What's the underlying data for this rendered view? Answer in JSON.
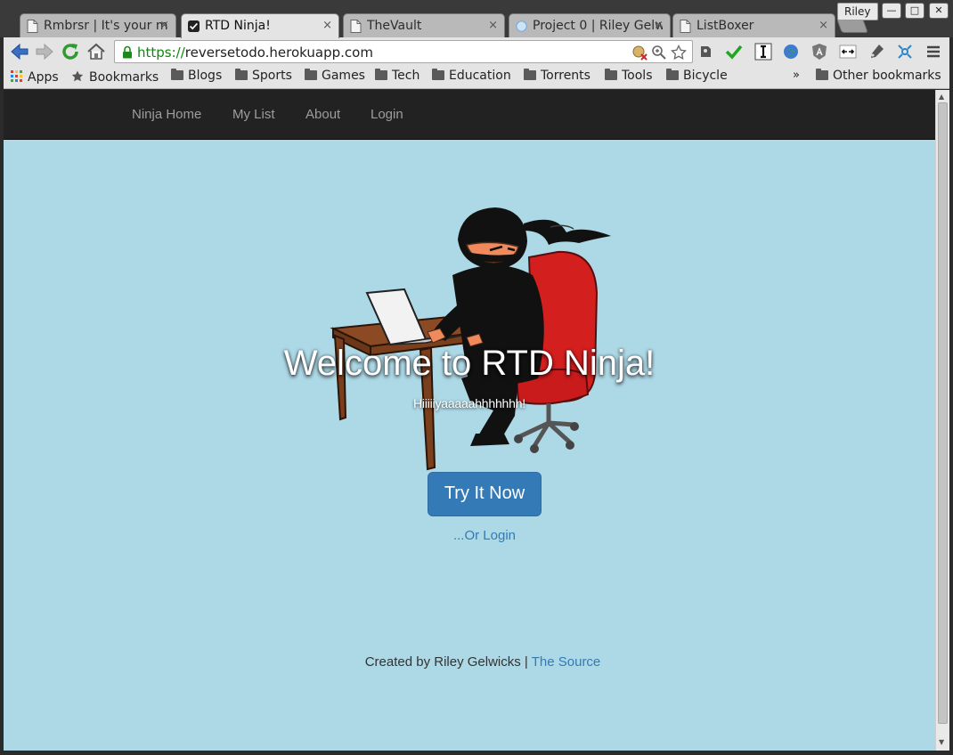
{
  "browser": {
    "profile_name": "Riley",
    "window_controls": {
      "minimize": "—",
      "maximize": "□",
      "close": "✕"
    },
    "tabs": [
      {
        "title": "Rmbrsr | It's your m",
        "icon": "page-icon",
        "active": false
      },
      {
        "title": "RTD Ninja!",
        "icon": "checkmark-favicon",
        "active": true
      },
      {
        "title": "TheVault",
        "icon": "page-icon",
        "active": false
      },
      {
        "title": "Project 0 | Riley Gelw",
        "icon": "globe-favicon",
        "active": false
      },
      {
        "title": "ListBoxer",
        "icon": "page-icon",
        "active": false
      }
    ],
    "tab_close_glyph": "×",
    "address": {
      "scheme": "https://",
      "host": "reversetodo.herokuapp.com"
    },
    "bookmarks": [
      {
        "label": "Apps",
        "icon": "apps-grid-icon"
      },
      {
        "label": "Bookmarks",
        "icon": "star-icon"
      },
      {
        "label": "Blogs",
        "icon": "folder-icon"
      },
      {
        "label": "Sports",
        "icon": "folder-icon"
      },
      {
        "label": "Games",
        "icon": "folder-icon"
      },
      {
        "label": "Tech",
        "icon": "folder-icon"
      },
      {
        "label": "Education",
        "icon": "folder-icon"
      },
      {
        "label": "Torrents",
        "icon": "folder-icon"
      },
      {
        "label": "Tools",
        "icon": "folder-icon"
      },
      {
        "label": "Bicycle",
        "icon": "folder-icon"
      }
    ],
    "bookmarks_overflow": "»",
    "other_bookmarks": "Other bookmarks"
  },
  "site": {
    "nav": [
      "Ninja Home",
      "My List",
      "About",
      "Login"
    ],
    "hero": {
      "title": "Welcome to RTD Ninja!",
      "subtitle": "Hiiiiiyaaaaahhhhhhh!",
      "cta_label": "Try It Now",
      "login_link": "...Or Login"
    },
    "footer": {
      "text": "Created by Riley Gelwicks |",
      "link": "The Source"
    }
  },
  "colors": {
    "page_background": "#add8e6",
    "navbar": "#222222",
    "primary_button": "#337ab7",
    "link": "#337ab7"
  }
}
